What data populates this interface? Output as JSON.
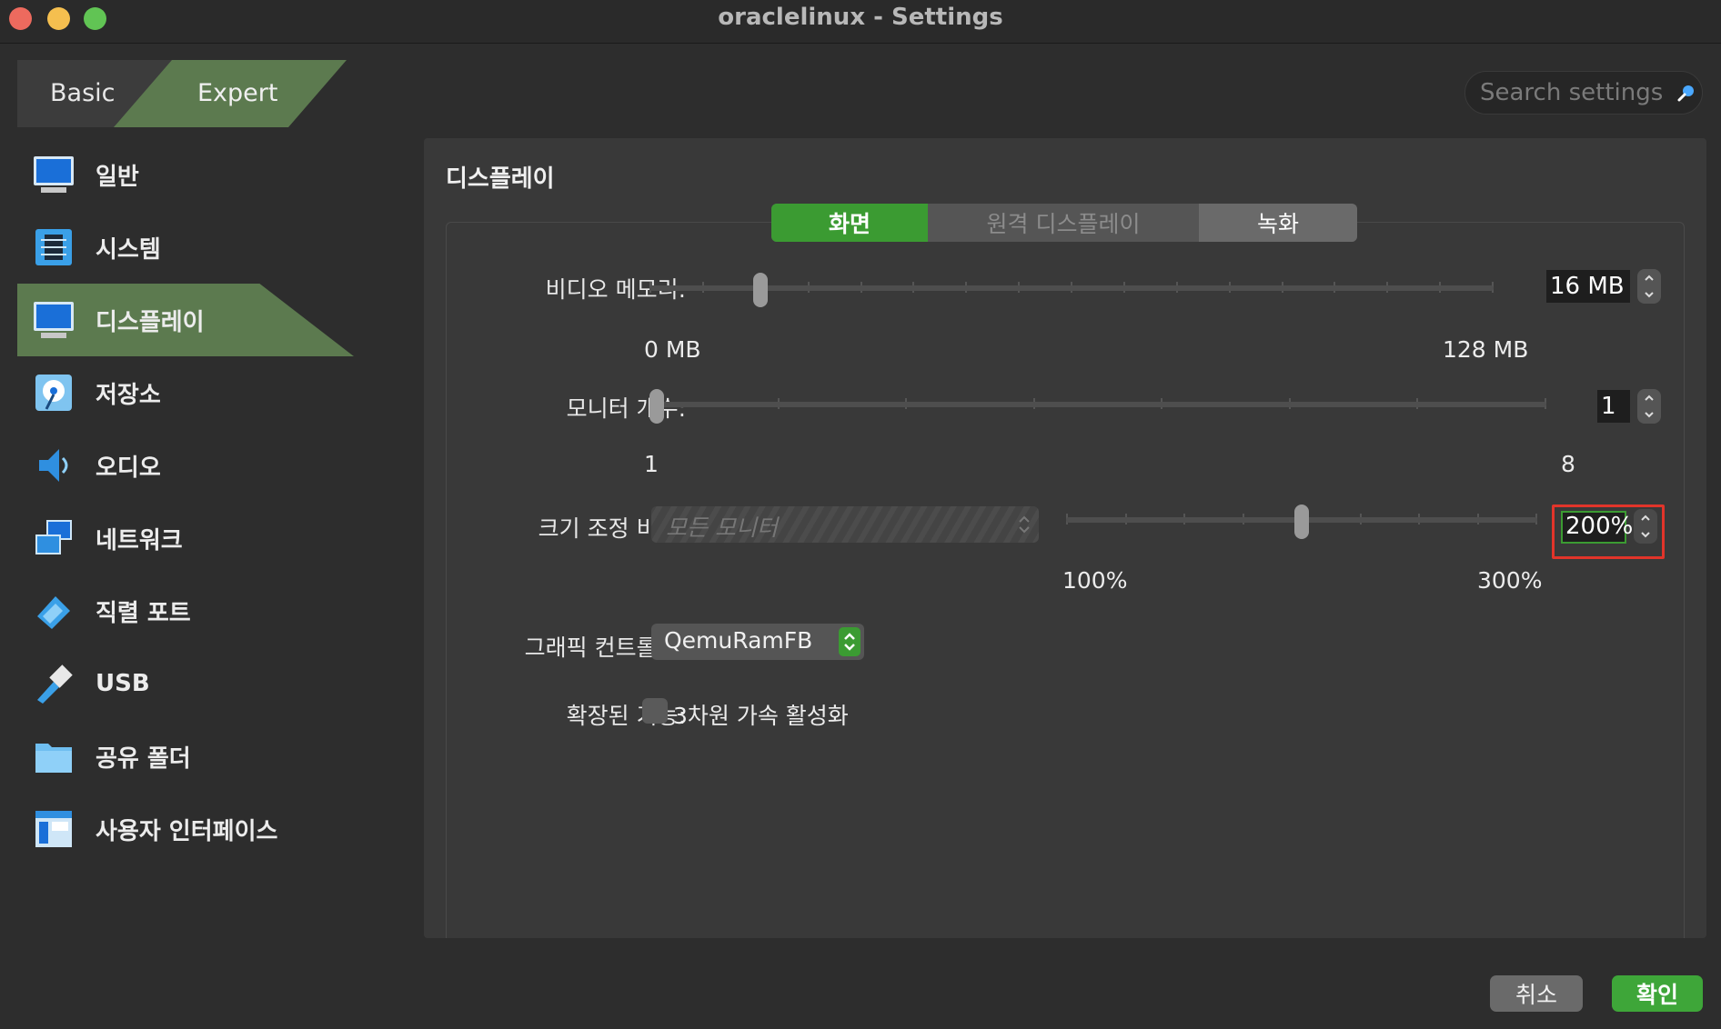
{
  "window": {
    "title": "oraclelinux - Settings"
  },
  "modes": {
    "basic": "Basic",
    "expert": "Expert"
  },
  "search": {
    "placeholder": "Search settings"
  },
  "sidebar": {
    "items": [
      {
        "label": "일반",
        "icon": "monitor-icon"
      },
      {
        "label": "시스템",
        "icon": "chip-icon"
      },
      {
        "label": "디스플레이",
        "icon": "display-icon",
        "active": true
      },
      {
        "label": "저장소",
        "icon": "disk-icon"
      },
      {
        "label": "오디오",
        "icon": "speaker-icon"
      },
      {
        "label": "네트워크",
        "icon": "network-icon"
      },
      {
        "label": "직렬 포트",
        "icon": "serial-port-icon"
      },
      {
        "label": "USB",
        "icon": "usb-icon"
      },
      {
        "label": "공유 폴더",
        "icon": "folder-icon"
      },
      {
        "label": "사용자 인터페이스",
        "icon": "ui-window-icon"
      }
    ]
  },
  "panel": {
    "title": "디스플레이",
    "tabs": {
      "screen": "화면",
      "remote": "원격 디스플레이",
      "record": "녹화"
    },
    "video_memory": {
      "label": "비디오 메모리:",
      "value": "16 MB",
      "min": "0 MB",
      "max": "128 MB",
      "fraction": 0.125
    },
    "monitor_count": {
      "label": "모니터 개수:",
      "value": "1",
      "min": "1",
      "max": "8",
      "fraction": 0.0
    },
    "scale": {
      "label": "크기 조정 비율:",
      "monitor_select": "모든 모니터",
      "value": "200%",
      "min": "100%",
      "max": "300%",
      "fraction": 0.5
    },
    "graphics_controller": {
      "label": "그래픽 컨트롤러:",
      "value": "QemuRamFB"
    },
    "extended": {
      "label": "확장된 기능:",
      "checkbox_label": "3차원 가속 활성화",
      "checked": false
    }
  },
  "buttons": {
    "cancel": "취소",
    "ok": "확인"
  },
  "colors": {
    "accent_green": "#3b9b32",
    "sidebar_active": "#5c7a4f",
    "highlight": "#e2342a"
  }
}
